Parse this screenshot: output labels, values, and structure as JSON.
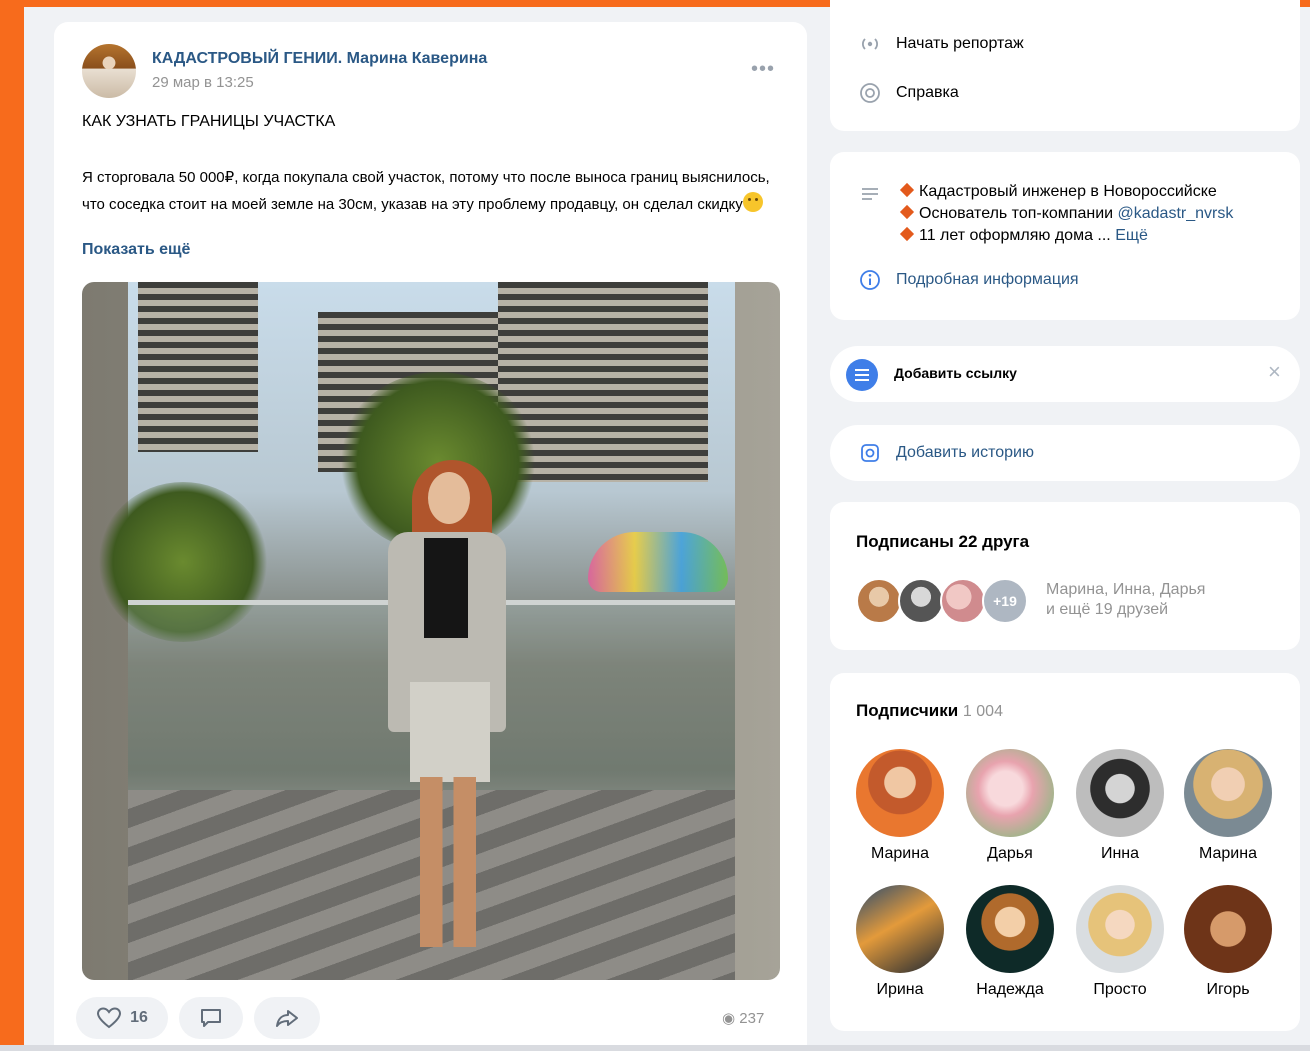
{
  "post": {
    "author": "КАДАСТРОВЫЙ ГЕНИИ. Марина Каверина",
    "date": "29 мар в 13:25",
    "menu": "•••",
    "title": "КАК УЗНАТЬ ГРАНИЦЫ УЧАСТКА",
    "text": "Я сторговала 50 000₽, когда покупала свой участок, потому что после выноса границ выяснилось, что соседка стоит на моей земле на 30см, указав на эту проблему продавцу, он сделал скидку",
    "show_more": "Показать ещё",
    "likes": "16",
    "views": "237"
  },
  "sidebar": {
    "actions": [
      {
        "label": "Начать репортаж",
        "icon": "broadcast-icon"
      },
      {
        "label": "Справка",
        "icon": "help-icon"
      }
    ],
    "about": {
      "lines": [
        {
          "text": "Кадастровый инженер в Новороссийске",
          "link": ""
        },
        {
          "text": "Основатель топ-компании ",
          "link": "@kadastr_nvrsk"
        },
        {
          "text": "11 лет оформляю дома ... ",
          "link": "Ещё"
        }
      ],
      "details": "Подробная информация"
    },
    "add_link": "Добавить ссылку",
    "add_story": "Добавить историю",
    "friends": {
      "title": "Подписаны 22 друга",
      "plus": "+19",
      "names": "Марина, Инна, Дарья",
      "more": "и ещё 19 друзей"
    },
    "followers": {
      "title": "Подписчики",
      "count": "1 004",
      "people": [
        {
          "name": "Марина"
        },
        {
          "name": "Дарья"
        },
        {
          "name": "Инна"
        },
        {
          "name": "Марина"
        },
        {
          "name": "Ирина"
        },
        {
          "name": "Надежда"
        },
        {
          "name": "Просто"
        },
        {
          "name": "Игорь"
        }
      ]
    }
  },
  "colors": {
    "frame": "#f76b1c",
    "link": "#2a5885",
    "accent_icon": "#3f7ee8"
  }
}
